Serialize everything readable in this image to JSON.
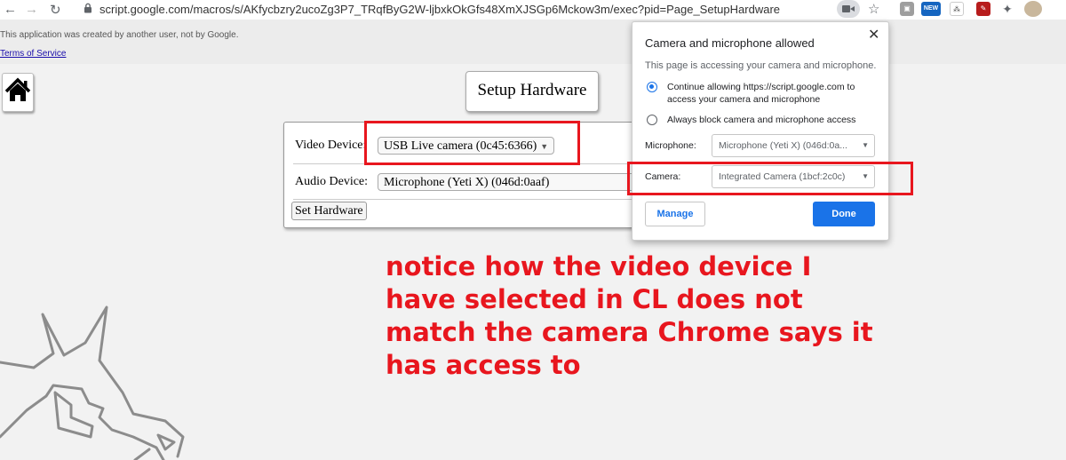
{
  "browser": {
    "url": "script.google.com/macros/s/AKfycbzry2ucoZg3P7_TRqfByG2W-ljbxkOkGfs48XmXJSGp6Mckow3m/exec?pid=Page_SetupHardware",
    "ext_new_label": "NEW",
    "icons": [
      "back-icon",
      "forward-icon",
      "reload-icon",
      "lock-icon",
      "camera-icon",
      "star-icon",
      "extensions-icon"
    ]
  },
  "banner": {
    "notice": "This application was created by another user, not by Google.",
    "terms_link": "Terms of Service"
  },
  "app": {
    "title": "Setup Hardware",
    "video_label": "Video Device:",
    "video_value": "USB Live camera (0c45:6366)",
    "audio_label": "Audio Device:",
    "audio_value": "Microphone (Yeti X) (046d:0aaf)",
    "set_button": "Set Hardware"
  },
  "popup": {
    "title": "Camera and microphone allowed",
    "subtitle": "This page is accessing your camera and microphone.",
    "option_allow": "Continue allowing https://script.google.com to access your camera and microphone",
    "option_block": "Always block camera and microphone access",
    "selected_option": "allow",
    "microphone_label": "Microphone:",
    "microphone_value": "Microphone (Yeti X) (046d:0a...",
    "camera_label": "Camera:",
    "camera_value": "Integrated Camera (1bcf:2c0c)",
    "manage_button": "Manage",
    "done_button": "Done",
    "close_glyph": "✕"
  },
  "annotation": {
    "lines": [
      "notice how the video device I",
      "have selected in CL does not",
      "match the camera Chrome says it",
      "has access to"
    ],
    "color": "#e8161e"
  },
  "colors": {
    "accent": "#1a73e8",
    "highlight": "#e8161e"
  }
}
